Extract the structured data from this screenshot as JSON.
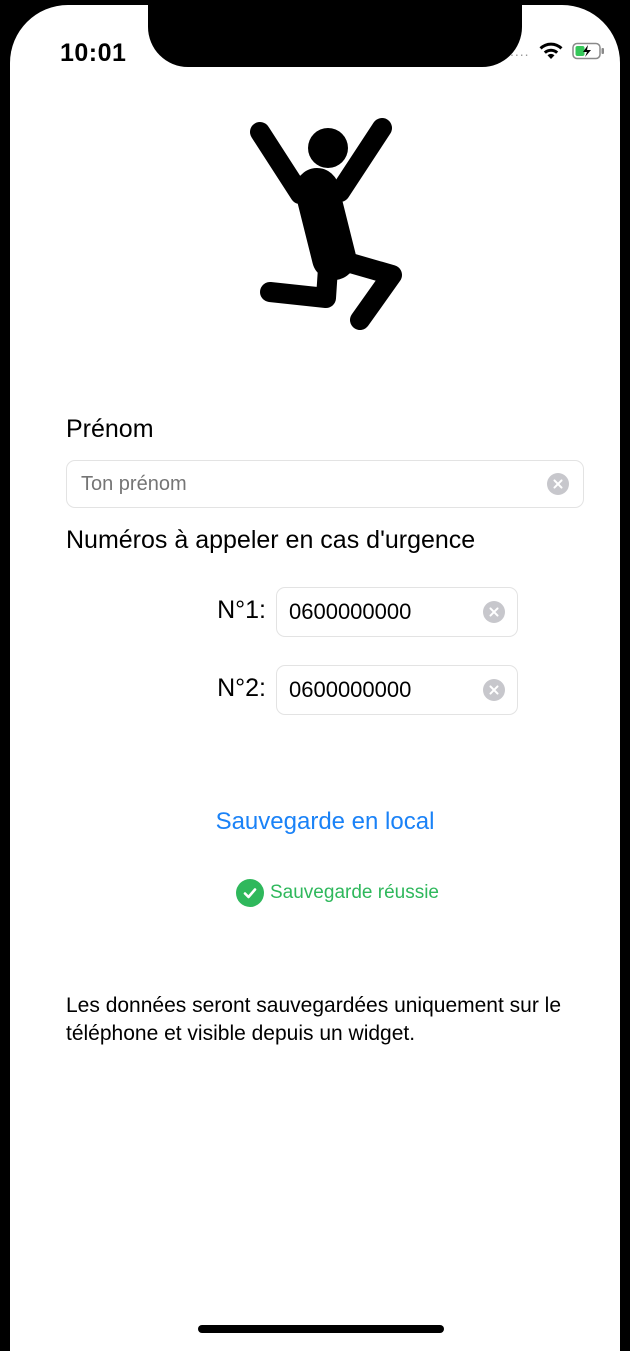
{
  "status_bar": {
    "time": "10:01",
    "signal": "....",
    "wifi_icon": "wifi-icon",
    "battery_icon": "battery-charging-icon"
  },
  "hero": {
    "icon": "jumping-person-icon"
  },
  "form": {
    "prenom_label": "Prénom",
    "prenom_placeholder": "Ton prénom",
    "prenom_value": "",
    "urgence_label": "Numéros à appeler en cas d'urgence",
    "numbers": [
      {
        "label": "N°1:",
        "value": "0600000000"
      },
      {
        "label": "N°2:",
        "value": "0600000000"
      }
    ]
  },
  "actions": {
    "save_label": "Sauvegarde en local",
    "success_label": "Sauvegarde réussie"
  },
  "info_text": "Les données seront sauvegardées uniquement sur le téléphone et visible depuis un widget.",
  "colors": {
    "accent": "#1a82f7",
    "success": "#2fb85c",
    "clear_button": "#c7c7cc"
  }
}
